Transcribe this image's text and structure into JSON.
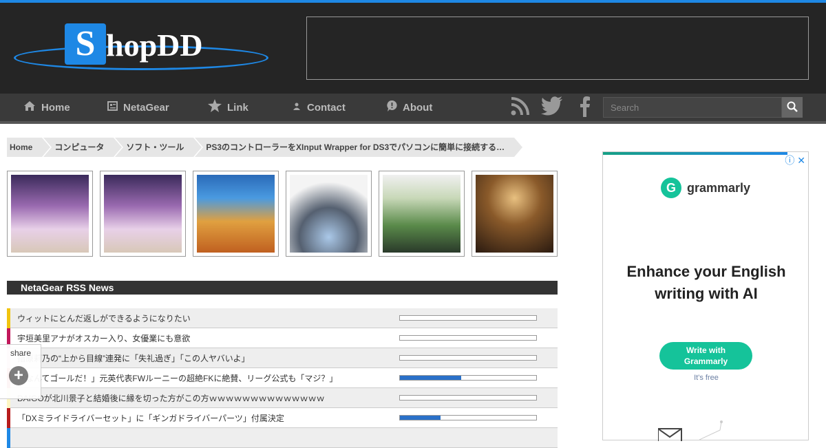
{
  "header": {
    "logo_letter": "S",
    "logo_rest": "hopDD",
    "accent_color": "#1e88e5"
  },
  "nav": {
    "items": [
      {
        "label": "Home",
        "icon": "home-icon"
      },
      {
        "label": "NetaGear",
        "icon": "newspaper-icon"
      },
      {
        "label": "Link",
        "icon": "star-icon"
      },
      {
        "label": "Contact",
        "icon": "person-icon"
      },
      {
        "label": "About",
        "icon": "info-bubble-icon"
      }
    ],
    "social": [
      "rss-icon",
      "twitter-icon",
      "facebook-icon"
    ],
    "search_placeholder": "Search"
  },
  "breadcrumb": [
    "Home",
    "コンピュータ",
    "ソフト・ツール",
    "PS3のコントローラーをXInput Wrapper for DS3でパソコンに簡単に接続する…"
  ],
  "thumbnails": [
    {
      "alt": "concert-dvd-1",
      "color": "#8a5a9c"
    },
    {
      "alt": "concert-dvd-2",
      "color": "#8a5a9c"
    },
    {
      "alt": "lion-king-bluray",
      "color": "#3a7fc8"
    },
    {
      "alt": "star-wars-set",
      "color": "#55606e"
    },
    {
      "alt": "album-cover-5-10",
      "color": "#7aa36b"
    },
    {
      "alt": "back-number-cover",
      "color": "#6b4a2a"
    }
  ],
  "rss": {
    "title": "NetaGear RSS News",
    "items": [
      {
        "text": "ウィットにとんだ返しができるようになりたい",
        "stripe": "#f1c40f",
        "progress": 0
      },
      {
        "text": "宇垣美里アナがオスカー入り、女優業にも意欲",
        "stripe": "#c2185b",
        "progress": 0
      },
      {
        "text": "指原莉乃の“上から目線”連発に「失礼過ぎ」「この人ヤバいよ」",
        "stripe": "#f8bbd0",
        "progress": 0
      },
      {
        "text": "「なんてゴールだ！」元英代表FWルーニーの超絶FKに絶賛、リーグ公式も「マジ？」",
        "stripe": "#e74c3c",
        "progress": 0.45
      },
      {
        "text": "DAIGOが北川景子と結婚後に縁を切った方がこの方ｗｗｗｗｗｗｗｗｗｗｗｗｗｗ",
        "stripe": "#fdf6c3",
        "progress": 0
      },
      {
        "text": "「DXミライドライバーセット」に「ギンガドライバーパーツ」付属決定",
        "stripe": "#b71c1c",
        "progress": 0.3
      },
      {
        "text": "",
        "stripe": "#1e88e5",
        "progress": 0
      }
    ]
  },
  "share": {
    "label": "share"
  },
  "side_ad": {
    "brand": "grammarly",
    "brand_letter": "G",
    "headline_1": "Enhance your English",
    "headline_2": "writing with AI",
    "cta_1": "Write with",
    "cta_2": "Grammarly",
    "free": "It's free",
    "brand_color": "#15c39a"
  }
}
